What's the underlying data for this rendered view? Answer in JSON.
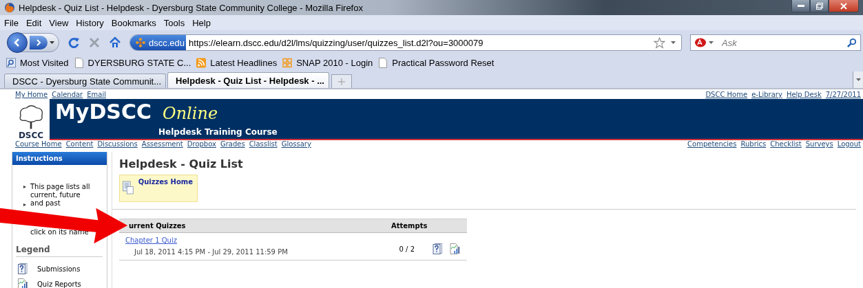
{
  "window": {
    "title": "Helpdesk - Quiz List - Helpdesk - Dyersburg State Community College - Mozilla Firefox"
  },
  "menu": [
    "File",
    "Edit",
    "View",
    "History",
    "Bookmarks",
    "Tools",
    "Help"
  ],
  "toolbar": {
    "site_badge": "dscc.edu",
    "url": "https://elearn.dscc.edu/d2l/lms/quizzing/user/quizzes_list.d2l?ou=3000079",
    "search_placeholder": "Ask"
  },
  "bookmarks": [
    {
      "kind": "search",
      "label": "Most Visited"
    },
    {
      "kind": "page",
      "label": "DYERSBURG STATE C..."
    },
    {
      "kind": "feed",
      "label": "Latest Headlines"
    },
    {
      "kind": "grid",
      "label": "SNAP 2010 - Login"
    },
    {
      "kind": "page",
      "label": "Practical Password Reset"
    }
  ],
  "tabs": [
    {
      "label": "DSCC - Dyersburg State Communit...",
      "selected": false
    },
    {
      "label": "Helpdesk - Quiz List - Helpdesk - ...",
      "selected": true
    }
  ],
  "page": {
    "top_links": [
      "My Home",
      "Calendar",
      "Email"
    ],
    "top_right_links": [
      "DSCC Home",
      "e-Library",
      "Help Desk",
      "7/27/2011"
    ],
    "banner": {
      "logo_text": "DSCC",
      "brand": "MyDSCC",
      "brand_script": "Online",
      "course": "Helpdesk Training Course"
    },
    "nav_left": [
      "Course Home",
      "Content",
      "Discussions",
      "Assessment",
      "Dropbox",
      "Grades",
      "Classlist",
      "Glossary"
    ],
    "nav_right": [
      "Competencies",
      "Rubrics",
      "Checklist",
      "Surveys",
      "Logout"
    ],
    "sidebar": {
      "heading": "Instructions",
      "instructions": [
        "This page lists all current, future and past",
        "click on its name"
      ],
      "legend_heading": "Legend",
      "legend": [
        {
          "kind": "submissions",
          "label": "Submissions"
        },
        {
          "kind": "reports",
          "label": "Quiz Reports"
        }
      ]
    },
    "main": {
      "title": "Helpdesk - Quiz List",
      "quizzes_home": "Quizzes Home",
      "table": {
        "columns": [
          "urrent Quizzes",
          "Attempts"
        ],
        "rows": [
          {
            "name": "Chapter 1 Quiz",
            "dates": "Jul 18, 2011 4:15 PM - Jul 29, 2011 11:59 PM",
            "attempts": "0 / 2"
          }
        ]
      }
    }
  }
}
